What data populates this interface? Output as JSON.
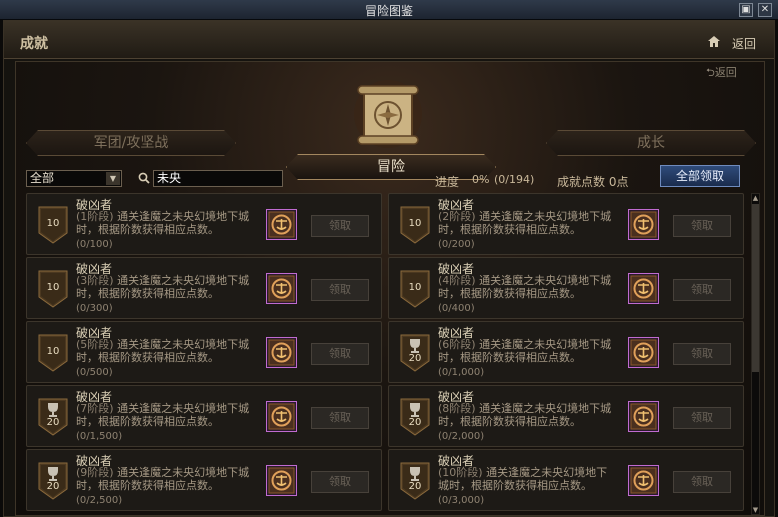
{
  "window": {
    "title": "冒险图鉴",
    "restore_glyph": "▣",
    "close_glyph": "✕"
  },
  "header": {
    "category": "成就",
    "back_label": "返回"
  },
  "panel": {
    "back_label": "返回"
  },
  "tabs": {
    "left": "军团/攻坚战",
    "main": "冒险",
    "right": "成长"
  },
  "filter": {
    "selected": "全部",
    "search_value": "未央"
  },
  "progress": {
    "label": "进度",
    "percent": "0%",
    "count": "(0/194)",
    "points": "成就点数 0点"
  },
  "claim_all_label": "全部领取",
  "achievements": [
    {
      "badge": "10",
      "badge_type": "shield",
      "name": "破凶者",
      "stage": "(1阶段)",
      "desc": "通关逢魔之未央幻境地下城时，根据阶数获得相应点数。",
      "progress": "(0/100)",
      "claim": "领取"
    },
    {
      "badge": "10",
      "badge_type": "shield",
      "name": "破凶者",
      "stage": "(2阶段)",
      "desc": "通关逢魔之未央幻境地下城时，根据阶数获得相应点数。",
      "progress": "(0/200)",
      "claim": "领取"
    },
    {
      "badge": "10",
      "badge_type": "shield",
      "name": "破凶者",
      "stage": "(3阶段)",
      "desc": "通关逢魔之未央幻境地下城时，根据阶数获得相应点数。",
      "progress": "(0/300)",
      "claim": "领取"
    },
    {
      "badge": "10",
      "badge_type": "shield",
      "name": "破凶者",
      "stage": "(4阶段)",
      "desc": "通关逢魔之未央幻境地下城时，根据阶数获得相应点数。",
      "progress": "(0/400)",
      "claim": "领取"
    },
    {
      "badge": "10",
      "badge_type": "shield",
      "name": "破凶者",
      "stage": "(5阶段)",
      "desc": "通关逢魔之未央幻境地下城时，根据阶数获得相应点数。",
      "progress": "(0/500)",
      "claim": "领取"
    },
    {
      "badge": "20",
      "badge_type": "trophy",
      "name": "破凶者",
      "stage": "(6阶段)",
      "desc": "通关逢魔之未央幻境地下城时，根据阶数获得相应点数。",
      "progress": "(0/1,000)",
      "claim": "领取"
    },
    {
      "badge": "20",
      "badge_type": "trophy",
      "name": "破凶者",
      "stage": "(7阶段)",
      "desc": "通关逢魔之未央幻境地下城时，根据阶数获得相应点数。",
      "progress": "(0/1,500)",
      "claim": "领取"
    },
    {
      "badge": "20",
      "badge_type": "trophy",
      "name": "破凶者",
      "stage": "(8阶段)",
      "desc": "通关逢魔之未央幻境地下城时，根据阶数获得相应点数。",
      "progress": "(0/2,000)",
      "claim": "领取"
    },
    {
      "badge": "20",
      "badge_type": "trophy",
      "name": "破凶者",
      "stage": "(9阶段)",
      "desc": "通关逢魔之未央幻境地下城时，根据阶数获得相应点数。",
      "progress": "(0/2,500)",
      "claim": "领取"
    },
    {
      "badge": "20",
      "badge_type": "trophy",
      "name": "破凶者",
      "stage": "(10阶段)",
      "desc": "通关逢魔之未央幻境地下城时，根据阶数获得相应点数。",
      "progress": "(0/3,000)",
      "claim": "领取"
    }
  ],
  "icons": {
    "home": "home-icon",
    "back": "back-arrow-icon",
    "search": "search-icon",
    "emblem": "scroll-compass-icon",
    "reward": "reward-emblem-icon"
  },
  "colors": {
    "accent_gold": "#a3875f",
    "claim_all_blue": "#2f4b7a",
    "reward_frame": "#c06bd0"
  }
}
